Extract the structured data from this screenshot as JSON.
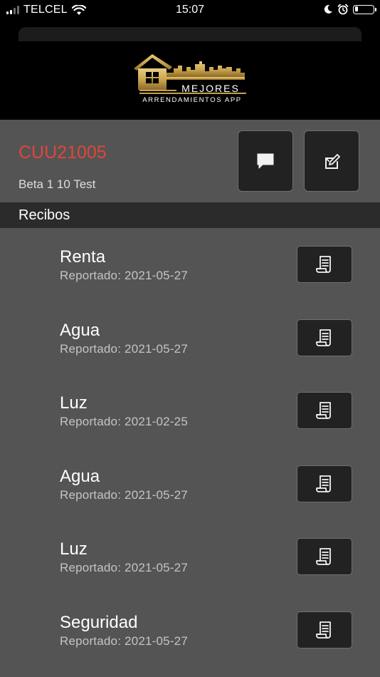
{
  "status_bar": {
    "carrier": "TELCEL",
    "time": "15:07"
  },
  "logo": {
    "word": "MEJORES",
    "subtitle": "ARRENDAMIENTOS APP",
    "gold": "#c9a24b"
  },
  "property": {
    "code": "CUU21005",
    "name": "Beta 1 10 Test",
    "code_color": "#e0463a"
  },
  "section": {
    "title": "Recibos"
  },
  "receipts": [
    {
      "title": "Renta",
      "date": "Reportado: 2021-05-27"
    },
    {
      "title": "Agua",
      "date": "Reportado: 2021-05-27"
    },
    {
      "title": "Luz",
      "date": "Reportado: 2021-02-25"
    },
    {
      "title": "Agua",
      "date": "Reportado: 2021-05-27"
    },
    {
      "title": "Luz",
      "date": "Reportado: 2021-05-27"
    },
    {
      "title": "Seguridad",
      "date": "Reportado: 2021-05-27"
    }
  ],
  "icons": {
    "chat": "chat-bubble-icon",
    "edit": "edit-document-icon",
    "receipt": "receipt-icon"
  },
  "battery_level": 0.15
}
